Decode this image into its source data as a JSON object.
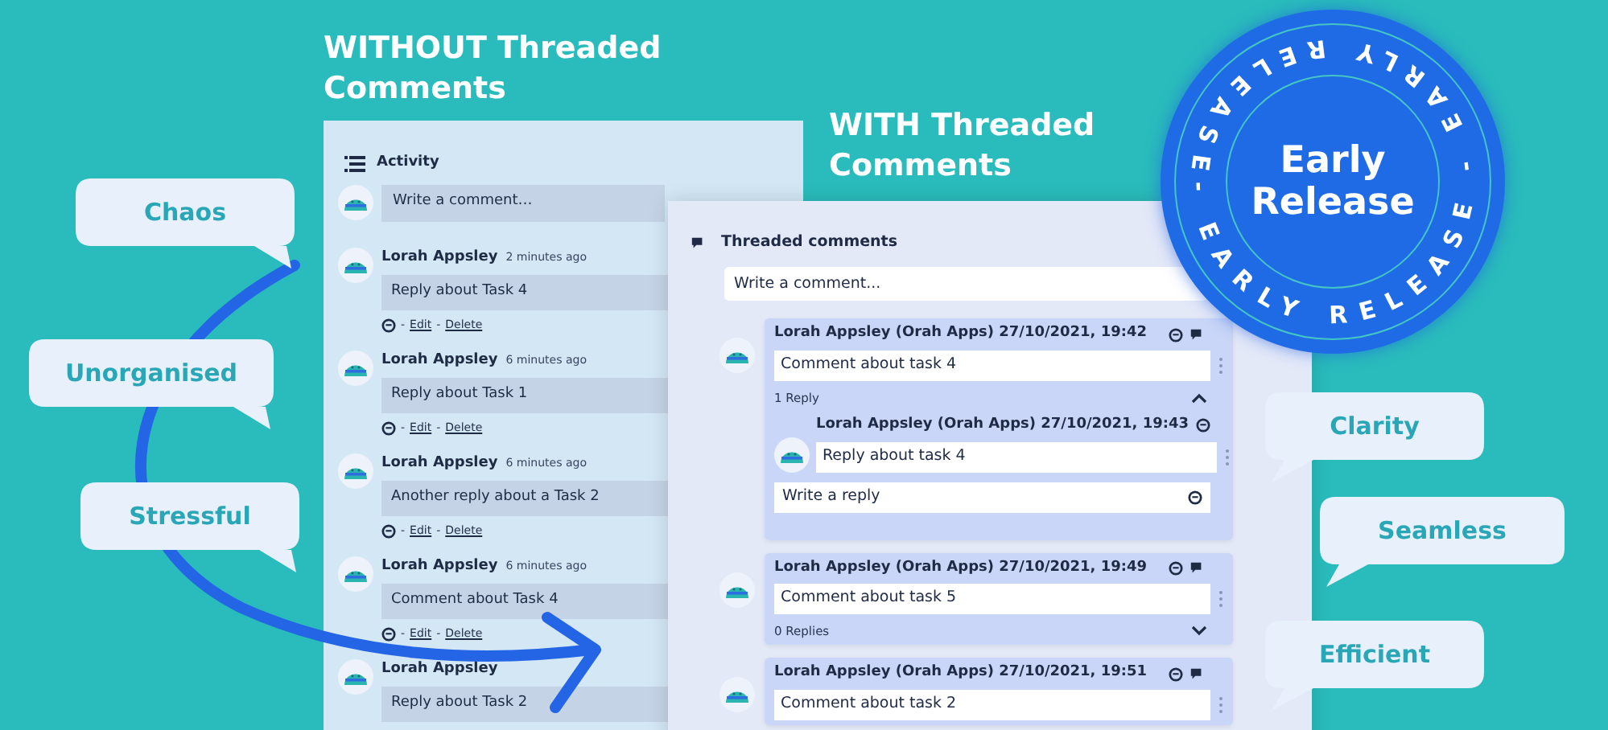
{
  "without": {
    "heading": "WITHOUT Threaded Comments",
    "title": "Activity",
    "placeholder": "Write a comment…",
    "comments": [
      {
        "author": "Lorah Appsley",
        "time": "2 minutes ago",
        "body": "Reply about Task 4",
        "separators": [
          "-",
          "-"
        ],
        "links": [
          "Edit",
          "Delete"
        ]
      },
      {
        "author": "Lorah Appsley",
        "time": "6 minutes ago",
        "body": "Reply about Task 1",
        "separators": [
          "-",
          "-"
        ],
        "links": [
          "Edit",
          "Delete"
        ]
      },
      {
        "author": "Lorah Appsley",
        "time": "6 minutes ago",
        "body": "Another reply about a Task 2",
        "separators": [
          "-",
          "-"
        ],
        "links": [
          "Edit",
          "Delete"
        ]
      },
      {
        "author": "Lorah Appsley",
        "time": "6 minutes ago",
        "body": "Comment about Task 4",
        "separators": [
          "-",
          "-"
        ],
        "links": [
          "Edit",
          "Delete"
        ]
      },
      {
        "author": "Lorah Appsley",
        "body": "Reply about Task 2"
      }
    ]
  },
  "with": {
    "heading": "WITH Threaded Comments",
    "title": "Threaded comments",
    "placeholder": "Write a comment...",
    "threads": [
      {
        "header": "Lorah Appsley (Orah Apps) 27/10/2021, 19:42",
        "body": "Comment about task 4",
        "replies_label": "1 Reply",
        "expanded": true,
        "replies": [
          {
            "header": "Lorah Appsley (Orah Apps) 27/10/2021, 19:43",
            "body": "Reply about task 4"
          }
        ],
        "reply_placeholder": "Write a reply"
      },
      {
        "header": "Lorah Appsley (Orah Apps) 27/10/2021, 19:49",
        "body": "Comment about task 5",
        "replies_label": "0 Replies",
        "expanded": false
      },
      {
        "header": "Lorah Appsley (Orah Apps) 27/10/2021, 19:51",
        "body": "Comment about task 2",
        "expanded": false
      }
    ]
  },
  "problems": [
    "Chaos",
    "Unorganised",
    "Stressful"
  ],
  "benefits": [
    "Clarity",
    "Seamless",
    "Efficient"
  ],
  "badge": {
    "title": "Early Release",
    "ring_text": "- EARLY RELEASE - EARLY RELEASE "
  }
}
